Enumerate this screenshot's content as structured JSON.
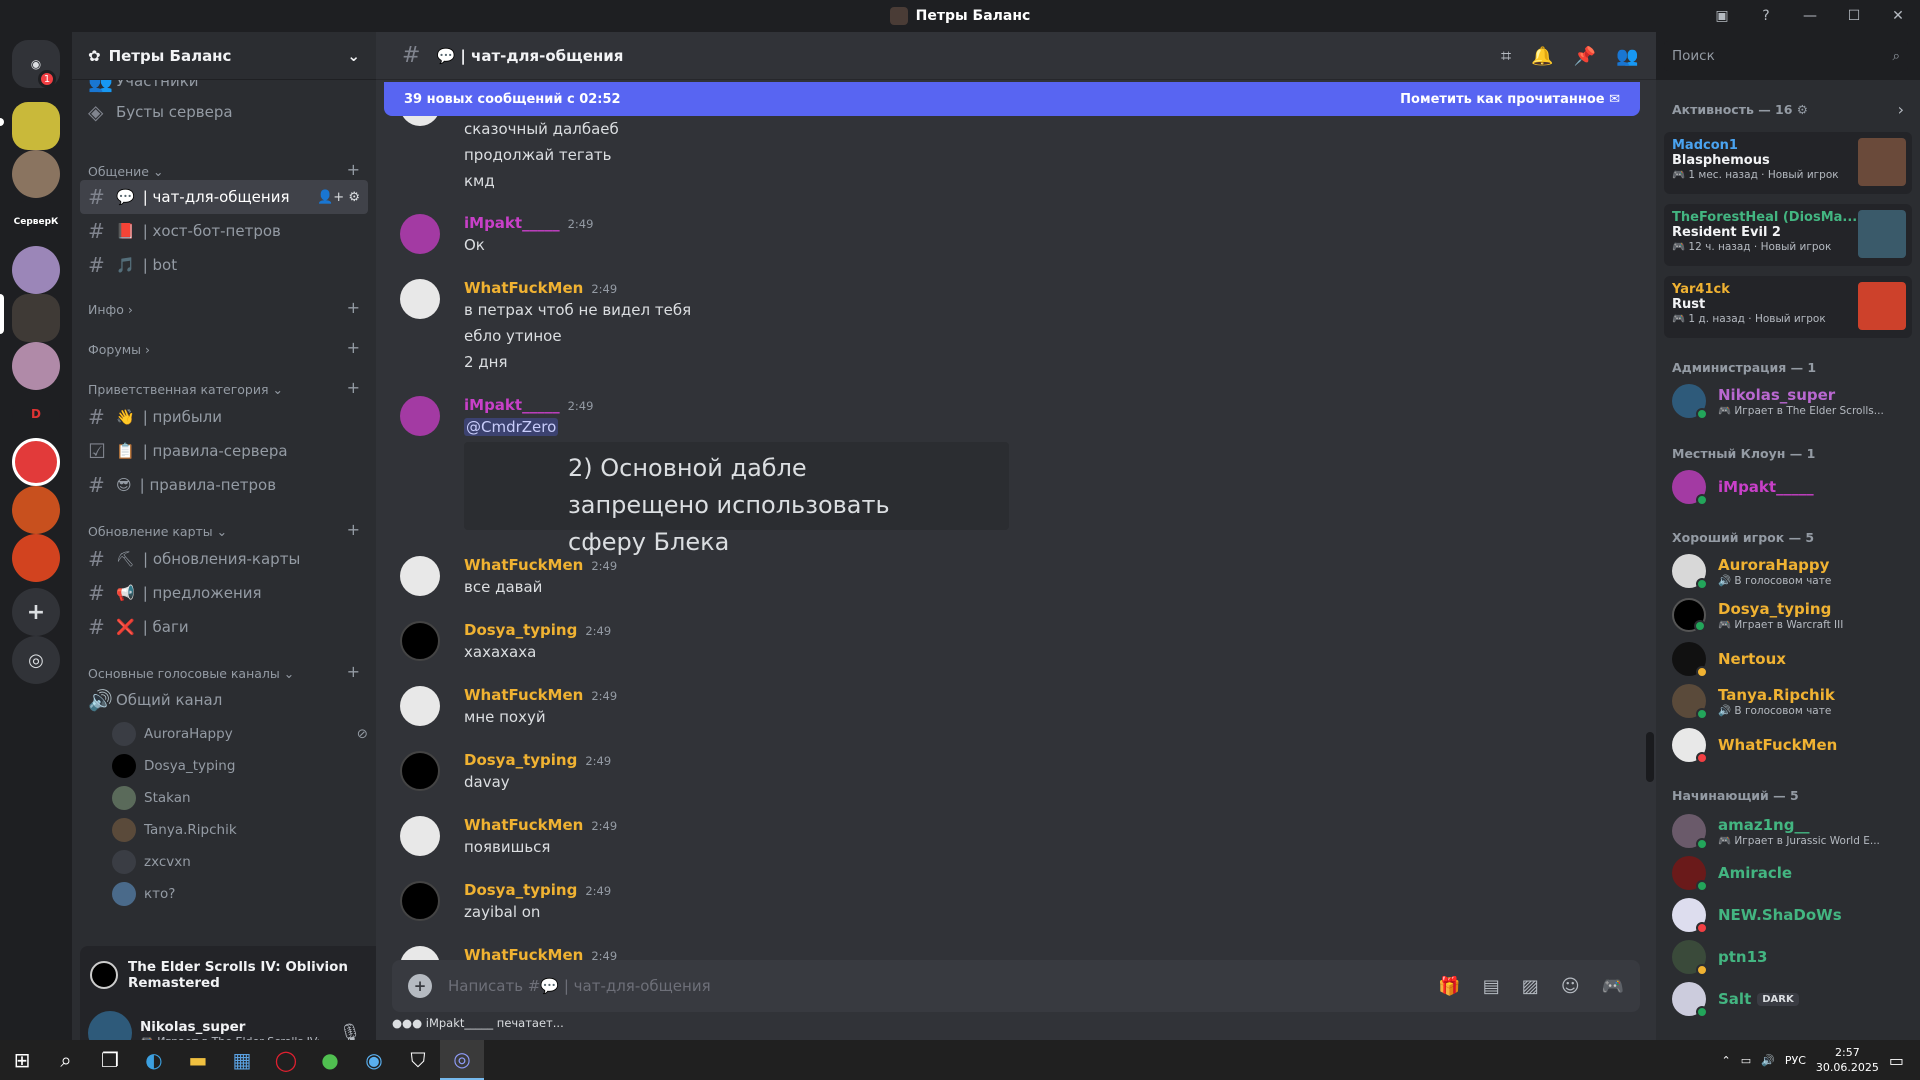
{
  "window": {
    "title": "Петры Баланс",
    "controls": [
      "—",
      "☐",
      "✕"
    ]
  },
  "server": {
    "name": "Петры Баланс",
    "top_partial": "Участники",
    "boosts": "Бусты сервера"
  },
  "guild_badge": "1",
  "guild_label": "СерверК",
  "categories": [
    {
      "name": "Общение ⌄",
      "plus": "+"
    },
    {
      "name": "Инфо ›",
      "plus": "+"
    },
    {
      "name": "Форумы ›",
      "plus": "+"
    },
    {
      "name": "Приветственная категория ⌄",
      "plus": "+"
    },
    {
      "name": "Обновление карты ⌄",
      "plus": "+"
    },
    {
      "name": "Основные голосовые каналы ⌄",
      "plus": "+"
    }
  ],
  "channels": [
    {
      "icon": "💬",
      "label": "| чат-для-общения"
    },
    {
      "icon": "📕",
      "label": "| хост-бот-петров"
    },
    {
      "icon": "🎵",
      "label": "| bot"
    },
    {
      "icon": "👋",
      "label": "| прибыли"
    },
    {
      "icon": "📋",
      "label": "| правила-сервера"
    },
    {
      "icon": "😎",
      "label": "| правила-петров"
    },
    {
      "icon": "⛏",
      "label": "| обновления-карты"
    },
    {
      "icon": "📢",
      "label": "| предложения"
    },
    {
      "icon": "❌",
      "label": "| баги"
    }
  ],
  "voice": {
    "name": "Общий канал",
    "users": [
      "AuroraHappy",
      "Dosya_typing",
      "Stakan",
      "Tanya.Ripchik",
      "zxcvxn",
      "кто?"
    ]
  },
  "activity_game": "The Elder Scrolls IV: Oblivion Remastered",
  "me": {
    "name": "Nikolas_super",
    "status": "🎮 Играет в The Elder Scrolls IV:"
  },
  "header": {
    "hash": "#",
    "channel": "💬 | чат-для-общения"
  },
  "newbar": {
    "text": "39 новых сообщений с 02:52",
    "action": "Пометить как прочитанное"
  },
  "messages": [
    {
      "lines": [
        "сказочный далбаеб",
        "продолжай тегать",
        "кмд"
      ]
    },
    {
      "author": "iMpakt_____",
      "color": "#c840c8",
      "time": "2:49",
      "lines": [
        "Ок"
      ]
    },
    {
      "author": "WhatFuckMen",
      "color": "#f0b232",
      "time": "2:49",
      "lines": [
        "в петрах чтоб не видел тебя",
        "ебло утиное",
        "2 дня"
      ]
    },
    {
      "author": "iMpakt_____",
      "color": "#c840c8",
      "time": "2:49",
      "mention": "@CmdrZero",
      "embed": "2) Основной дабле запрещено использовать сферу Блека"
    },
    {
      "author": "WhatFuckMen",
      "color": "#f0b232",
      "time": "2:49",
      "lines": [
        "все давай"
      ]
    },
    {
      "author": "Dosya_typing",
      "color": "#f0b232",
      "time": "2:49",
      "lines": [
        "хахахаха"
      ]
    },
    {
      "author": "WhatFuckMen",
      "color": "#f0b232",
      "time": "2:49",
      "lines": [
        "мне похуй"
      ]
    },
    {
      "author": "Dosya_typing",
      "color": "#f0b232",
      "time": "2:49",
      "lines": [
        "davay"
      ]
    },
    {
      "author": "WhatFuckMen",
      "color": "#f0b232",
      "time": "2:49",
      "lines": [
        "появишься"
      ]
    },
    {
      "author": "Dosya_typing",
      "color": "#f0b232",
      "time": "2:49",
      "lines": [
        "zayibal on"
      ]
    },
    {
      "author": "WhatFuckMen",
      "color": "#f0b232",
      "time": "2:49",
      "lines": []
    }
  ],
  "composer": {
    "placeholder": "Написать #💬 | чат-для-общения"
  },
  "typing": "●●● iMpakt_____ печатает...",
  "search": {
    "placeholder": "Поиск"
  },
  "members": {
    "activity_title": "Активность — 16 ⚙",
    "cards": [
      {
        "user": "Madcon1",
        "color": "#4aa3f0",
        "game": "Blasphemous",
        "meta": "🎮 1 мес. назад",
        "tag": "Новый игрок"
      },
      {
        "user": "TheForestHeal (DiosMa...",
        "color": "#43b581",
        "game": "Resident Evil 2",
        "meta": "🎮 12 ч. назад",
        "tag": "Новый игрок"
      },
      {
        "user": "Yar41ck",
        "color": "#f0b232",
        "game": "Rust",
        "meta": "🎮 1 д. назад",
        "tag": "Новый игрок"
      }
    ],
    "groups": [
      {
        "title": "Администрация — 1",
        "items": [
          {
            "name": "Nikolas_super",
            "color": "#b968d0",
            "status": "🎮 Играет в The Elder Scrolls..."
          }
        ]
      },
      {
        "title": "Местный Клоун — 1",
        "items": [
          {
            "name": "iMpakt_____",
            "color": "#c840c8",
            "status": ""
          }
        ]
      },
      {
        "title": "Хороший игрок — 5",
        "items": [
          {
            "name": "AuroraHappy",
            "color": "#f0b232",
            "status": "🔊 В голосовом чате"
          },
          {
            "name": "Dosya_typing",
            "color": "#f0b232",
            "status": "🎮 Играет в Warcraft III"
          },
          {
            "name": "Nertoux",
            "color": "#f0b232",
            "status": ""
          },
          {
            "name": "Tanya.Ripchik",
            "color": "#f0b232",
            "status": "🔊 В голосовом чате"
          },
          {
            "name": "WhatFuckMen",
            "color": "#f0b232",
            "status": ""
          }
        ]
      },
      {
        "title": "Начинающий — 5",
        "items": [
          {
            "name": "amaz1ng__",
            "color": "#43b581",
            "status": "🎮 Играет в Jurassic World E..."
          },
          {
            "name": "Amiracle",
            "color": "#43b581",
            "status": ""
          },
          {
            "name": "NEW.ShaDoWs",
            "color": "#43b581",
            "status": ""
          },
          {
            "name": "ptn13",
            "color": "#43b581",
            "status": ""
          },
          {
            "name": "Salt",
            "color": "#43b581",
            "status": "",
            "tag": "DARK"
          }
        ]
      }
    ]
  },
  "taskbar": {
    "lang": "РУС",
    "time": "2:57",
    "date": "30.06.2025"
  }
}
